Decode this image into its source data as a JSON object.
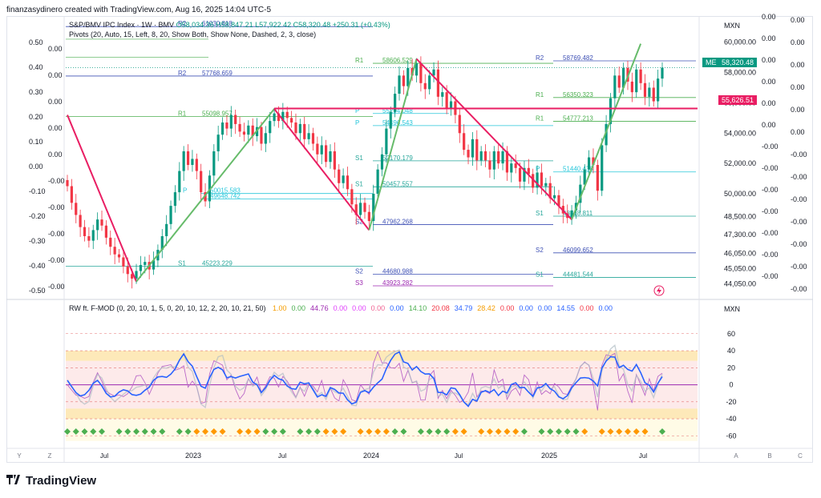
{
  "header": {
    "text": "finanzasydinero created with TradingView.com, Aug 16, 2025 14:04 UTC-5"
  },
  "legend": {
    "symbol": "S&P/BMV IPC Index · 1W · BMV",
    "ohlc": "O58,034.36 H58,847.21 L57,922.42 C58,320.48 +250.31 (+0.43%)",
    "pivots": "Pivots (20, Auto, 15, Left, 8, 20, Show Both, Show None, Dashed, 2, 3, close)",
    "oscillator_name": "RW ft. F-MOD (0, 20, 10, 1, 5, 0, 20, 10, 12, 2, 20, 10, 21, 50)",
    "oscillator_values": [
      {
        "v": "1.00",
        "c": "#f59d00"
      },
      {
        "v": "0.00",
        "c": "#4caf50"
      },
      {
        "v": "44.76",
        "c": "#9c27b0"
      },
      {
        "v": "0.00",
        "c": "#e040fb"
      },
      {
        "v": "0.00",
        "c": "#e040fb"
      },
      {
        "v": "0.00",
        "c": "#f06292"
      },
      {
        "v": "0.00",
        "c": "#2962ff"
      },
      {
        "v": "14.10",
        "c": "#4caf50"
      },
      {
        "v": "20.08",
        "c": "#f23645"
      },
      {
        "v": "34.79",
        "c": "#2962ff"
      },
      {
        "v": "28.42",
        "c": "#f59d00"
      },
      {
        "v": "0.00",
        "c": "#f23645"
      },
      {
        "v": "0.00",
        "c": "#2962ff"
      },
      {
        "v": "0.00",
        "c": "#2962ff"
      },
      {
        "v": "14.55",
        "c": "#2962ff"
      },
      {
        "v": "0.00",
        "c": "#f23645"
      },
      {
        "v": "0.00",
        "c": "#2962ff"
      }
    ]
  },
  "currency_top": "MXN",
  "currency_bottom": "MXN",
  "colors": {
    "up": "#089981",
    "down": "#f23645",
    "pivot_line": "#e91e63",
    "zigzag_up": "#66bb6a",
    "r_level": "#4caf50",
    "s_level": "#26a69a",
    "blue_level": "#3f51b5",
    "purple_level": "#9c27b0"
  },
  "price_axis": {
    "ticks": [
      "60,000.00",
      "58,000.00",
      "56,000.00",
      "54,000.00",
      "52,000.00",
      "50,000.00",
      "48,500.00",
      "47,300.00",
      "46,050.00",
      "45,050.00",
      "44,050.00"
    ],
    "last_price": "58,320.48",
    "last_tag": "ME",
    "pivot_price": "55,626.51"
  },
  "left_axis_a": [
    "0.50",
    "0.40",
    "0.30",
    "0.20",
    "0.10",
    "0.00",
    "-0.10",
    "-0.20",
    "-0.30",
    "-0.40",
    "-0.50"
  ],
  "left_axis_b": [
    "0.00",
    "0.00",
    "0.00",
    "0.00",
    "0.00",
    "-0.00",
    "-0.00",
    "-0.00",
    "-0.00",
    "-0.00"
  ],
  "right_axis_a": [
    "0.00",
    "0.00",
    "0.00",
    "0.00",
    "0.00",
    "0.00",
    "-0.00",
    "-0.00",
    "-0.00",
    "-0.00",
    "-0.00",
    "-0.00",
    "-0.00"
  ],
  "right_axis_b": [
    "0.00",
    "0.00",
    "0.00",
    "0.00",
    "0.00",
    "0.00",
    "-0.00",
    "-0.00",
    "-0.00",
    "-0.00",
    "-0.00",
    "-0.00",
    "-0.00"
  ],
  "osc_axis": [
    "60",
    "40",
    "20",
    "0",
    "-20",
    "-40",
    "-60"
  ],
  "time_axis": [
    "Jul",
    "2023",
    "Jul",
    "2024",
    "Jul",
    "2025",
    "Jul"
  ],
  "nav_buttons": [
    "Y",
    "Z",
    "A",
    "B",
    "C"
  ],
  "levels": [
    {
      "label": "R2",
      "value": "61030.818"
    },
    {
      "label": "R1",
      "value": "58606.529"
    },
    {
      "label": "R2",
      "value": "57768.659"
    },
    {
      "label": "R1",
      "value": "55098.957"
    },
    {
      "label": "P",
      "value": "54496.543"
    },
    {
      "label": "P",
      "value": "55294.048"
    },
    {
      "label": "S1",
      "value": "52170.179"
    },
    {
      "label": "S1",
      "value": "50457.557"
    },
    {
      "label": "P",
      "value": "50015.583"
    },
    {
      "label": "",
      "value": "49648.742"
    },
    {
      "label": "S2",
      "value": "47962.268"
    },
    {
      "label": "S1",
      "value": "45223.229"
    },
    {
      "label": "S2",
      "value": "44680.988"
    },
    {
      "label": "S3",
      "value": "43923.282"
    },
    {
      "label": "R2",
      "value": "58769.482"
    },
    {
      "label": "R1",
      "value": "56350.323"
    },
    {
      "label": "R1",
      "value": "54777.213"
    },
    {
      "label": "P",
      "value": "51440.438"
    },
    {
      "label": "S1",
      "value": "48518.811"
    },
    {
      "label": "S2",
      "value": "46099.652"
    },
    {
      "label": "S1",
      "value": "44481.544"
    }
  ],
  "chart_data": {
    "type": "candlestick",
    "title": "S&P/BMV IPC Index · 1W · BMV",
    "ylabel": "MXN",
    "ylim": [
      43500,
      61200
    ],
    "x_ticks": [
      "Jul",
      "2023",
      "Jul",
      "2024",
      "Jul",
      "2025",
      "Jul"
    ],
    "series_close": [
      50500,
      49400,
      48600,
      47800,
      47200,
      46900,
      47600,
      48300,
      47900,
      47100,
      46500,
      46000,
      45800,
      45200,
      44700,
      44400,
      44900,
      45300,
      45500,
      45000,
      45600,
      46300,
      47200,
      48000,
      49200,
      50100,
      51500,
      52800,
      51900,
      52300,
      51500,
      50100,
      49500,
      51200,
      52800,
      53900,
      54700,
      54300,
      55200,
      54600,
      54100,
      53900,
      54500,
      53800,
      54400,
      53300,
      54000,
      54800,
      55300,
      54800,
      55400,
      55000,
      54700,
      54000,
      54600,
      53600,
      54000,
      53300,
      52600,
      53200,
      52100,
      52800,
      51600,
      50700,
      51200,
      50300,
      49300,
      48600,
      49400,
      48800,
      48200,
      50000,
      51600,
      52600,
      54300,
      55400,
      56600,
      57800,
      57100,
      58300,
      57800,
      58600,
      57300,
      56900,
      57800,
      58200,
      56400,
      56700,
      55600,
      56100,
      55200,
      54000,
      52900,
      52400,
      53600,
      52200,
      52800,
      52200,
      51600,
      52800,
      52000,
      52800,
      51400,
      52000,
      51700,
      50800,
      51700,
      51300,
      50400,
      51400,
      50500,
      50700,
      49700,
      49900,
      49200,
      48700,
      48400,
      48900,
      49400,
      50600,
      51600,
      52400,
      51900,
      50200,
      53200,
      54600,
      56300,
      57800,
      57000,
      58300,
      57400,
      56700,
      58200,
      57300,
      56400,
      57000,
      56100,
      57600,
      58320
    ]
  }
}
